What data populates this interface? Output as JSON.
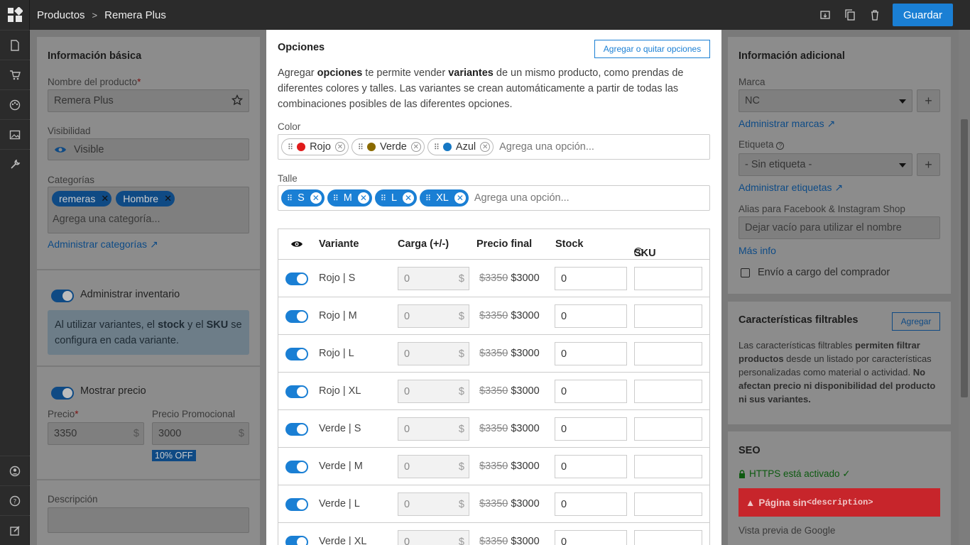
{
  "breadcrumb": {
    "parent": "Productos",
    "separator": ">",
    "current": "Remera Plus"
  },
  "toolbar": {
    "save_label": "Guardar"
  },
  "basic": {
    "title": "Información básica",
    "name_label": "Nombre del producto",
    "name_required": "*",
    "name_value": "Remera Plus",
    "visibility_label": "Visibilidad",
    "visibility_value": "Visible",
    "categories_label": "Categorías",
    "categories": [
      "remeras",
      "Hombre"
    ],
    "categories_placeholder": "Agrega una categoría...",
    "manage_categories": "Administrar categorías ↗"
  },
  "inventory": {
    "toggle_label": "Administrar inventario",
    "note_pre": "Al utilizar variantes, el ",
    "note_stock": "stock",
    "note_mid": " y el ",
    "note_sku": "SKU",
    "note_post": " se configura en cada variante."
  },
  "price": {
    "toggle_label": "Mostrar precio",
    "price_label": "Precio",
    "price_required": "*",
    "price_value": "3350",
    "promo_label": "Precio Promocional",
    "promo_value": "3000",
    "currency": "$",
    "discount_badge": "10% OFF"
  },
  "description": {
    "label": "Descripción"
  },
  "options_modal": {
    "title": "Opciones",
    "manage_button": "Agregar o quitar opciones",
    "desc_1": "Agregar ",
    "desc_b1": "opciones",
    "desc_2": " te permite vender ",
    "desc_b2": "variantes",
    "desc_3": " de un mismo producto, como prendas de diferentes colores y talles. Las variantes se crean automáticamente a partir de todas las combinaciones posibles de las diferentes opciones.",
    "color_label": "Color",
    "colors": [
      {
        "name": "Rojo",
        "swatch": "#e01b1b"
      },
      {
        "name": "Verde",
        "swatch": "#8a6a00"
      },
      {
        "name": "Azul",
        "swatch": "#1577c4"
      }
    ],
    "size_label": "Talle",
    "sizes": [
      "S",
      "M",
      "L",
      "XL"
    ],
    "add_option_placeholder": "Agrega una opción...",
    "table_headers": {
      "variant": "Variante",
      "load": "Carga (+/-)",
      "final_price": "Precio final",
      "stock": "Stock",
      "sku": "SKU"
    },
    "variants": [
      {
        "name": "Rojo | S",
        "load": "0",
        "old_price": "$3350",
        "price": "$3000",
        "stock": "0"
      },
      {
        "name": "Rojo | M",
        "load": "0",
        "old_price": "$3350",
        "price": "$3000",
        "stock": "0"
      },
      {
        "name": "Rojo | L",
        "load": "0",
        "old_price": "$3350",
        "price": "$3000",
        "stock": "0"
      },
      {
        "name": "Rojo | XL",
        "load": "0",
        "old_price": "$3350",
        "price": "$3000",
        "stock": "0"
      },
      {
        "name": "Verde | S",
        "load": "0",
        "old_price": "$3350",
        "price": "$3000",
        "stock": "0"
      },
      {
        "name": "Verde | M",
        "load": "0",
        "old_price": "$3350",
        "price": "$3000",
        "stock": "0"
      },
      {
        "name": "Verde | L",
        "load": "0",
        "old_price": "$3350",
        "price": "$3000",
        "stock": "0"
      },
      {
        "name": "Verde | XL",
        "load": "0",
        "old_price": "$3350",
        "price": "$3000",
        "stock": "0"
      }
    ],
    "currency": "$"
  },
  "additional": {
    "title": "Información adicional",
    "brand_label": "Marca",
    "brand_value": "NC",
    "manage_brands": "Administrar marcas ↗",
    "tag_label": "Etiqueta",
    "tag_value": "- Sin etiqueta -",
    "manage_tags": "Administrar etiquetas ↗",
    "alias_label": "Alias para Facebook & Instagram Shop",
    "alias_placeholder": "Dejar vacío para utilizar el nombre",
    "more_info": "Más info",
    "shipping_label": "Envío a cargo del comprador"
  },
  "filters": {
    "title": "Características filtrables",
    "add_button": "Agregar",
    "t1": "Las características filtrables ",
    "b1": "permiten filtrar productos",
    "t2": " desde un listado por características personalizadas como material o actividad. ",
    "b2": "No afectan precio ni disponibilidad del producto ni sus variantes."
  },
  "seo": {
    "title": "SEO",
    "https": "HTTPS está activado ✓",
    "warning_pre": "Página sin ",
    "warning_code": "<description>",
    "google_preview": "Vista previa de Google"
  },
  "colors": {
    "accent": "#1a7fd4",
    "danger": "#d61f26",
    "https_green": "#0d5a10"
  }
}
